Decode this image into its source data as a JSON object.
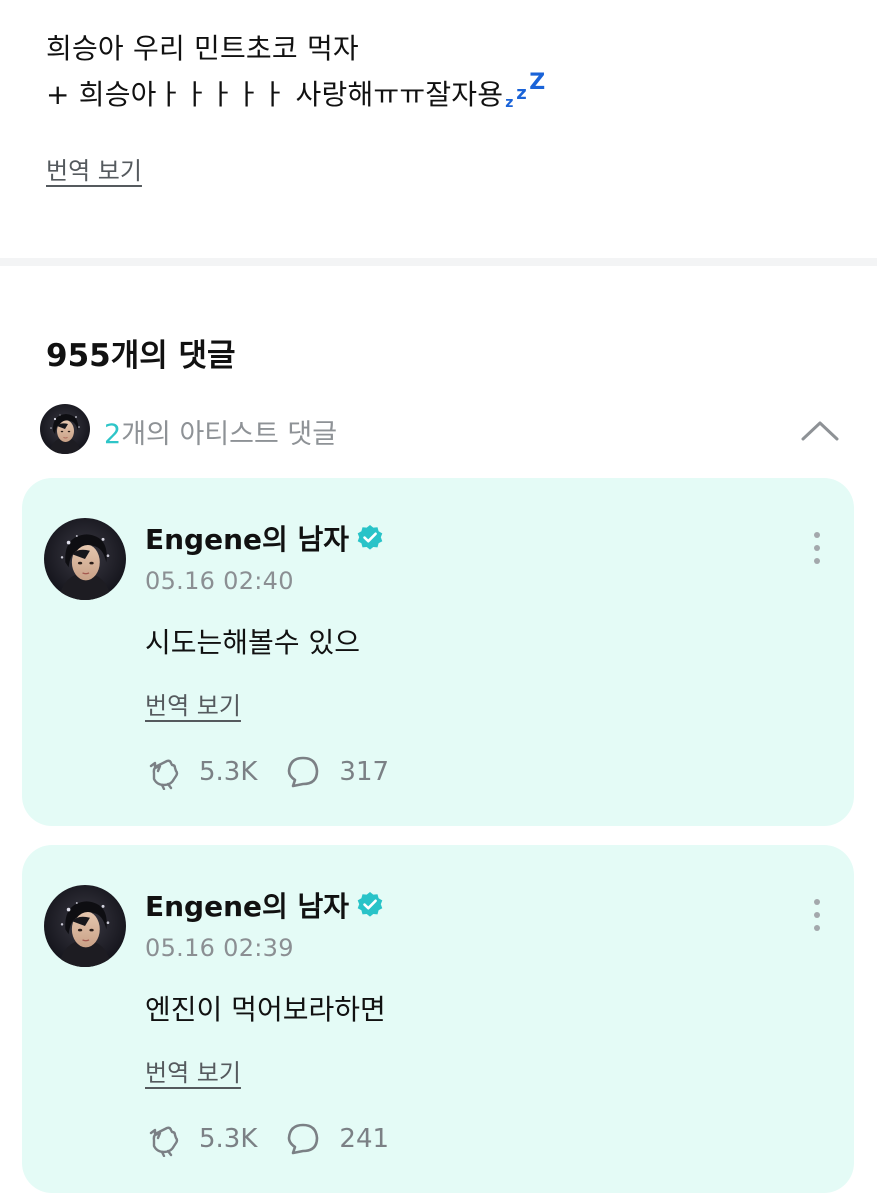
{
  "post": {
    "line1": "희승아 우리 민트초코 먹자",
    "line2": "+ 희승아ㅏㅏㅏㅏㅏ 사랑해ㅠㅠ잘자용",
    "sleep_emoji": {
      "z_small": "z",
      "z_mid": "z",
      "z_big": "Z"
    },
    "translate_label": "번역 보기"
  },
  "comments_header": {
    "count_label": "955개의 댓글",
    "artist_count": "2",
    "artist_label_rest": "개의 아티스트 댓글"
  },
  "comments": [
    {
      "author": "Engene의 남자",
      "time": "05.16 02:40",
      "text": "시도는해볼수 있으",
      "translate_label": "번역 보기",
      "likes": "5.3K",
      "replies": "317"
    },
    {
      "author": "Engene의 남자",
      "time": "05.16 02:39",
      "text": "엔진이 먹어보라하면",
      "translate_label": "번역 보기",
      "likes": "5.3K",
      "replies": "241"
    }
  ],
  "colors": {
    "card_background": "#e4fbf6",
    "accent_teal": "#2ec5c8",
    "verified_badge": "#29c3c8",
    "zzz_blue": "#1a63d8",
    "muted_text": "#8b8f93"
  },
  "icons": [
    "sleeping-zzz-icon",
    "chevron-up-icon",
    "verified-badge-icon",
    "more-vertical-icon",
    "cheer-icon",
    "comment-bubble-icon"
  ]
}
